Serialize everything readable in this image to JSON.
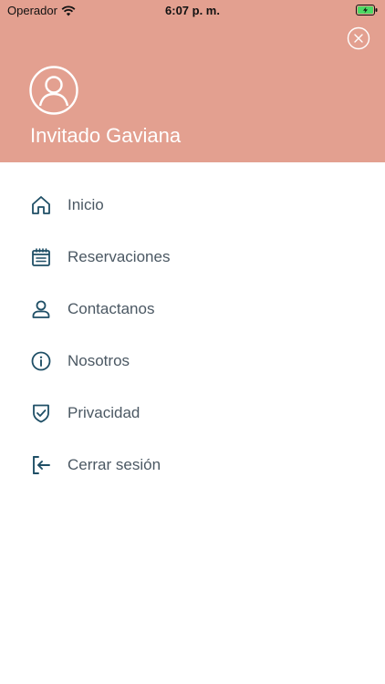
{
  "status_bar": {
    "carrier": "Operador",
    "time": "6:07 p. m."
  },
  "profile": {
    "name": "Invitado Gaviana"
  },
  "colors": {
    "header": "#e3a090",
    "icon": "#1f4f66",
    "label": "#4b5863"
  },
  "menu": {
    "items": [
      {
        "label": "Inicio",
        "icon": "home-icon"
      },
      {
        "label": "Reservaciones",
        "icon": "calendar-icon"
      },
      {
        "label": "Contactanos",
        "icon": "user-icon"
      },
      {
        "label": "Nosotros",
        "icon": "info-icon"
      },
      {
        "label": "Privacidad",
        "icon": "shield-check-icon"
      },
      {
        "label": "Cerrar sesión",
        "icon": "logout-icon"
      }
    ]
  }
}
